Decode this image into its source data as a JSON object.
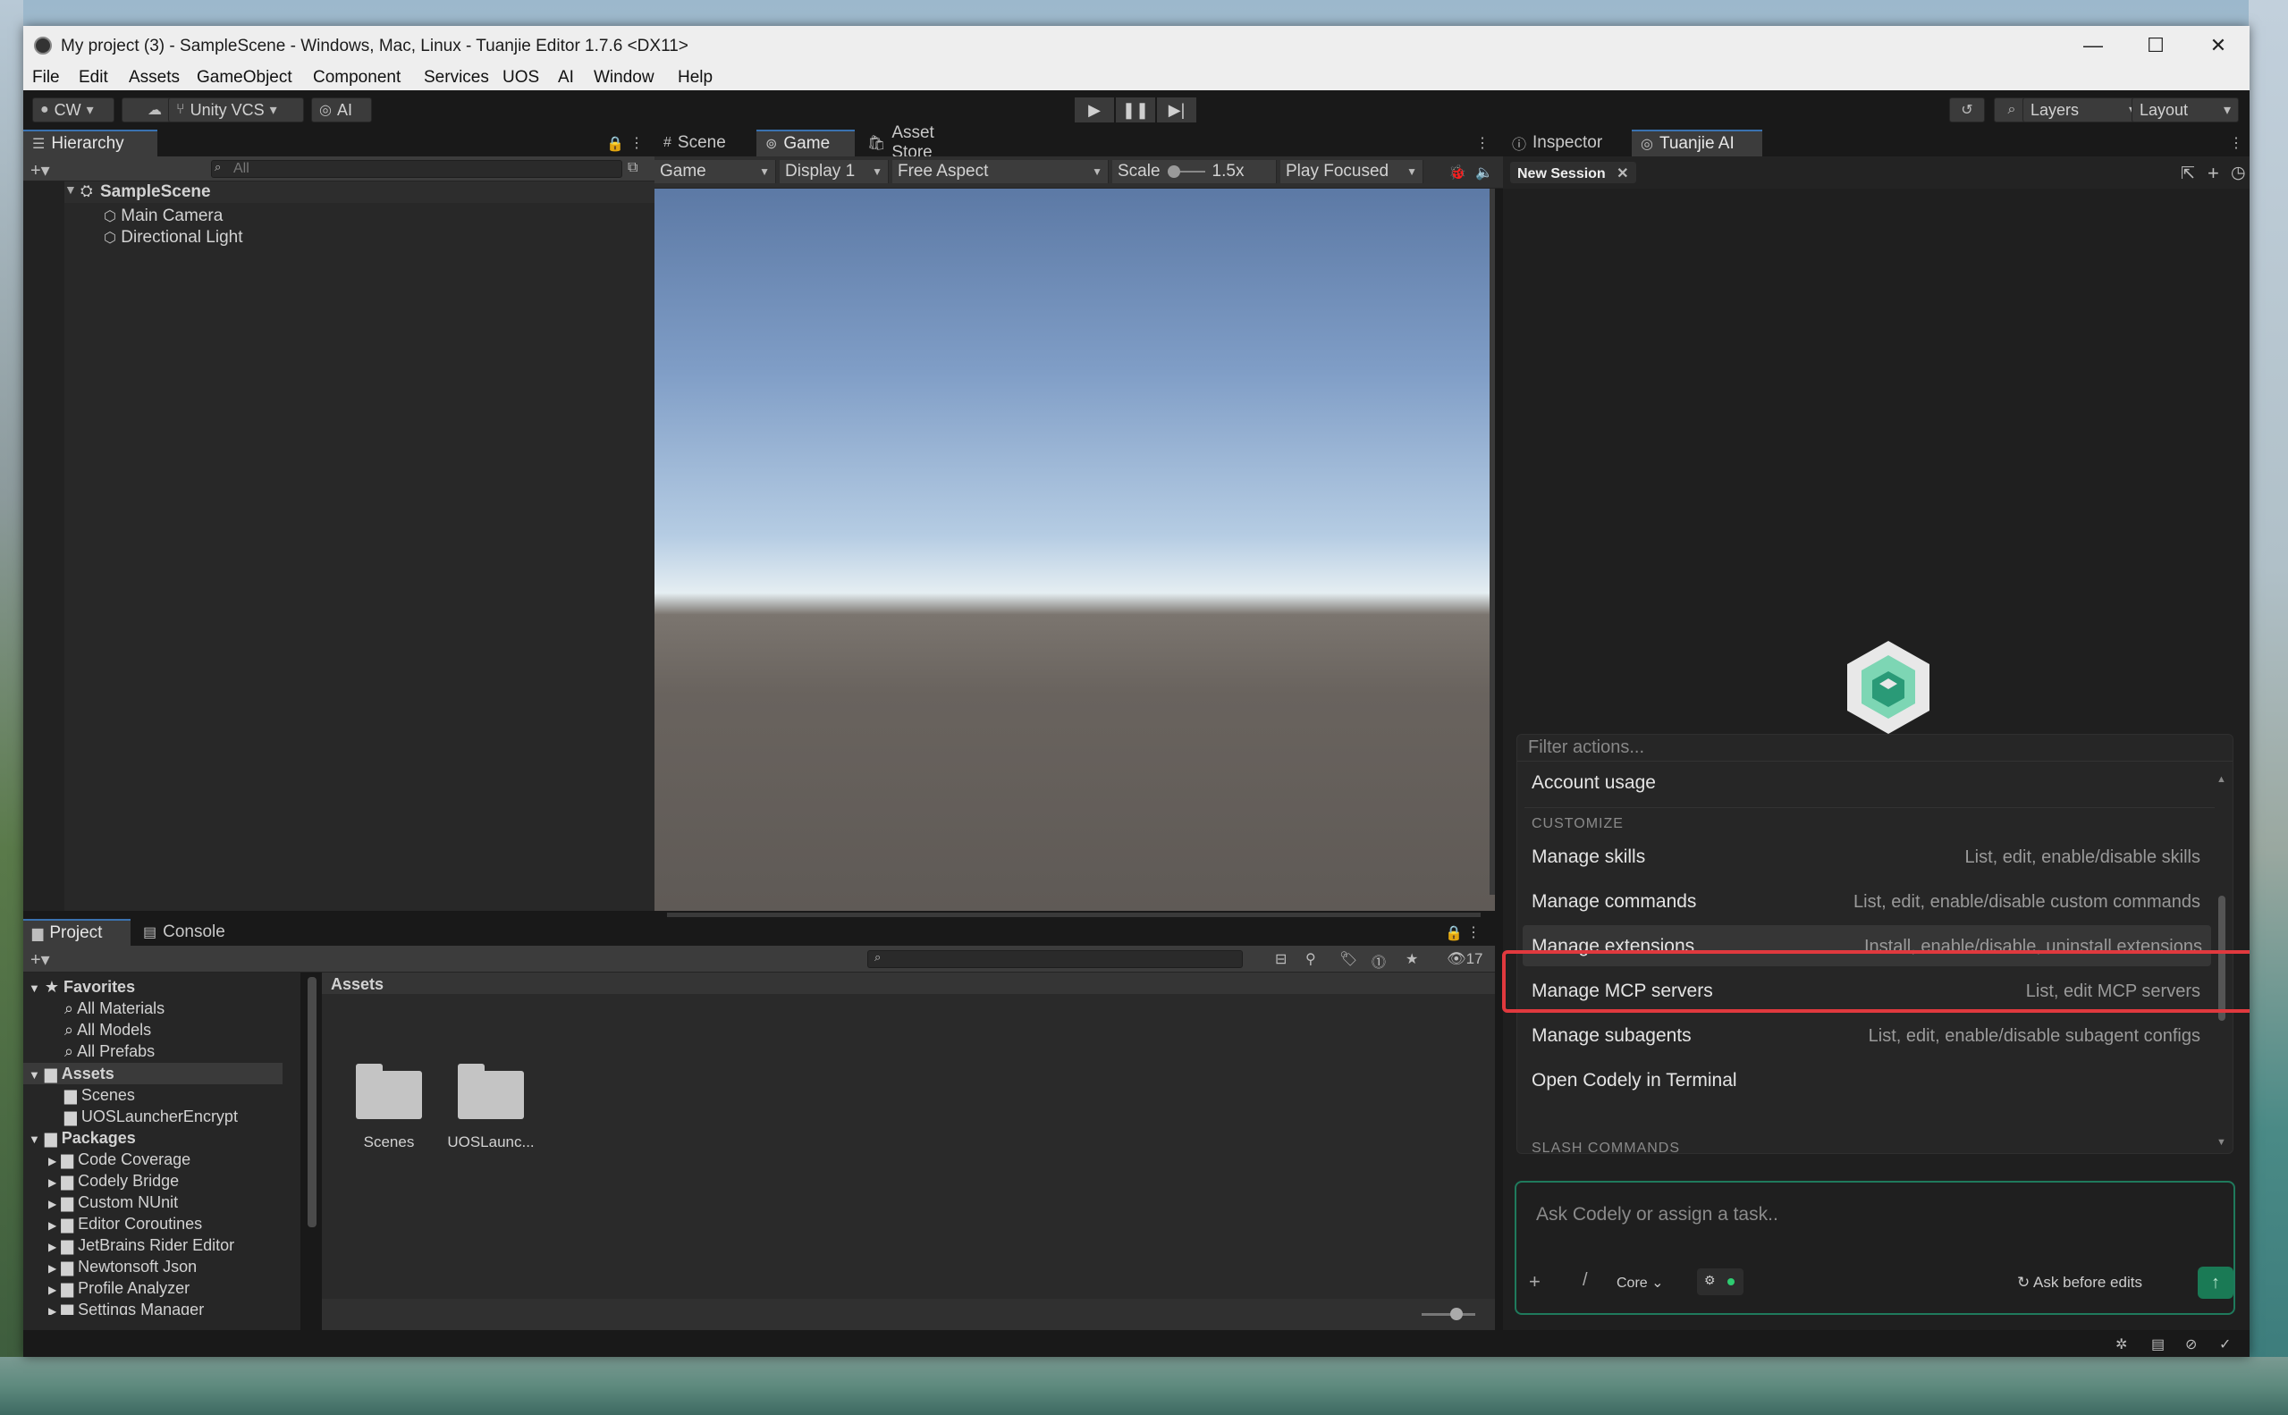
{
  "titlebar": {
    "title": "My project (3) - SampleScene - Windows, Mac, Linux - Tuanjie Editor 1.7.6 <DX11>",
    "minimize": "—",
    "maximize": "☐",
    "close": "✕"
  },
  "menu": [
    "File",
    "Edit",
    "Assets",
    "GameObject",
    "Component",
    "Services",
    "UOS",
    "AI",
    "Window",
    "Help"
  ],
  "toolbar": {
    "account": "CW",
    "vcs": "Unity VCS",
    "ai": "AI",
    "layers": "Layers",
    "layout": "Layout"
  },
  "hierarchy": {
    "tab": "Hierarchy",
    "search_placeholder": "All",
    "scene": "SampleScene",
    "items": [
      "Main Camera",
      "Directional Light"
    ]
  },
  "center_tabs": [
    "Scene",
    "Game",
    "Asset Store"
  ],
  "game_bar": {
    "view": "Game",
    "display": "Display 1",
    "aspect": "Free Aspect",
    "scale_label": "Scale",
    "scale_value": "1.5x",
    "play_mode": "Play Focused"
  },
  "project": {
    "tabs": [
      "Project",
      "Console"
    ],
    "hidden_count": "17",
    "path": "Assets",
    "favorites": {
      "label": "Favorites",
      "items": [
        "All Materials",
        "All Models",
        "All Prefabs"
      ]
    },
    "assets": {
      "label": "Assets",
      "items": [
        "Scenes",
        "UOSLauncherEncrypt"
      ]
    },
    "packages": {
      "label": "Packages",
      "items": [
        "Code Coverage",
        "Codely Bridge",
        "Custom NUnit",
        "Editor Coroutines",
        "JetBrains Rider Editor",
        "Newtonsoft Json",
        "Profile Analyzer",
        "Settings Manager"
      ]
    },
    "grid": [
      "Scenes",
      "UOSLaunc..."
    ]
  },
  "right_tabs": [
    "Inspector",
    "Tuanjie AI"
  ],
  "session_tab": "New Session",
  "popup": {
    "filter_placeholder": "Filter actions...",
    "top_item": "Account usage",
    "customize_label": "CUSTOMIZE",
    "slash_label": "SLASH COMMANDS",
    "commands": [
      {
        "name": "Manage skills",
        "desc": "List, edit, enable/disable skills"
      },
      {
        "name": "Manage commands",
        "desc": "List, edit, enable/disable custom commands"
      },
      {
        "name": "Manage extensions",
        "desc": "Install, enable/disable, uninstall extensions"
      },
      {
        "name": "Manage MCP servers",
        "desc": "List, edit MCP servers"
      },
      {
        "name": "Manage subagents",
        "desc": "List, edit, enable/disable subagent configs"
      },
      {
        "name": "Open Codely in Terminal",
        "desc": ""
      }
    ]
  },
  "composer": {
    "placeholder": "Ask Codely or assign a task..",
    "plus": "+",
    "slash": "/",
    "model": "Core",
    "mode": "Ask before edits"
  },
  "colors": {
    "highlight": "#e0393e",
    "accent": "#1f7a5c",
    "send": "#1a7a55"
  }
}
